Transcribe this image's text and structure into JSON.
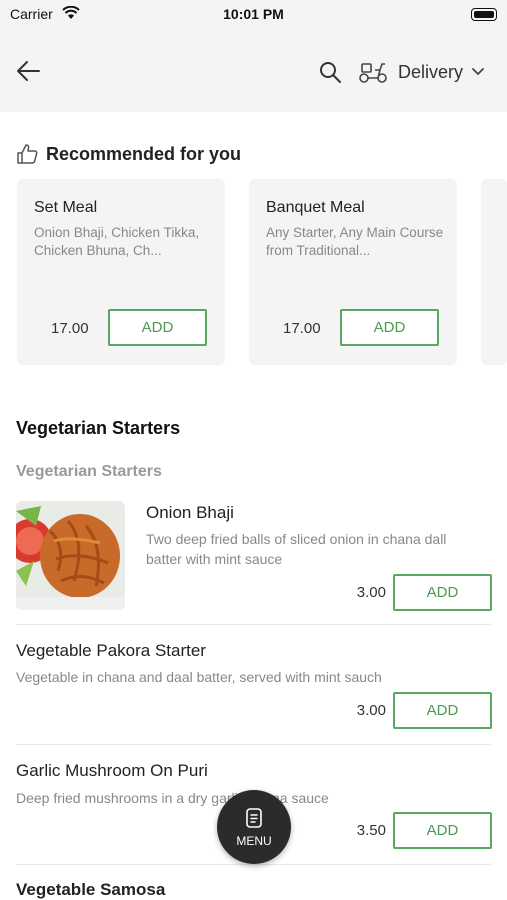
{
  "status_bar": {
    "carrier": "Carrier",
    "time": "10:01 PM"
  },
  "header": {
    "delivery_label": "Delivery"
  },
  "recommended": {
    "title": "Recommended for you",
    "cards": [
      {
        "title": "Set Meal",
        "description": "Onion Bhaji, Chicken Tikka, Chicken Bhuna, Ch...",
        "price": "17.00",
        "add_label": "ADD"
      },
      {
        "title": "Banquet Meal",
        "description": "Any Starter, Any Main Course from Traditional...",
        "price": "17.00",
        "add_label": "ADD"
      }
    ]
  },
  "menu": {
    "section_title": "Vegetarian Starters",
    "subsection_title": "Vegetarian Starters",
    "items": [
      {
        "name": "Onion Bhaji",
        "description": "Two deep fried balls of sliced onion in chana dall batter with mint sauce",
        "price": "3.00",
        "add_label": "ADD"
      },
      {
        "name": "Vegetable Pakora Starter",
        "description": "Vegetable in chana and daal batter, served with mint sauch",
        "price": "3.00",
        "add_label": "ADD"
      },
      {
        "name": "Garlic Mushroom On Puri",
        "description": "Deep fried mushrooms in a dry garlic bhuna sauce",
        "price": "3.50",
        "add_label": "ADD"
      },
      {
        "name": "Vegetable Samosa"
      }
    ]
  },
  "fab": {
    "label": "MENU"
  },
  "colors": {
    "accent": "#5aa85f",
    "header_bg": "#f4f4f4",
    "fab_bg": "#2b2b2b"
  }
}
